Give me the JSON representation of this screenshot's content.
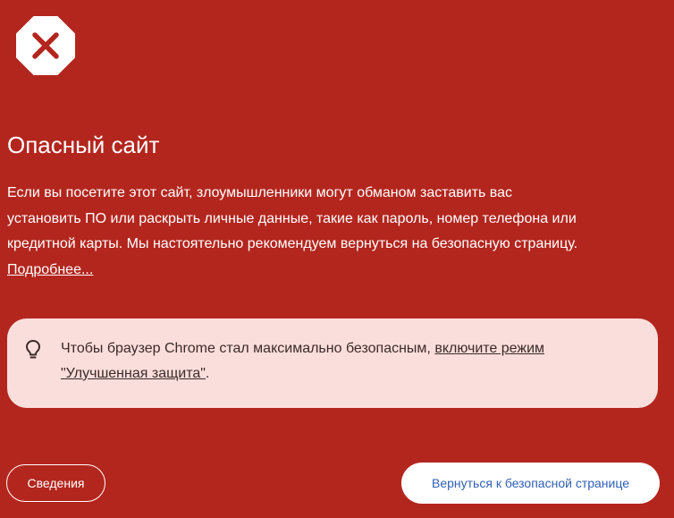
{
  "icons": {
    "warning": "close-x-octagon",
    "tip": "lightbulb"
  },
  "colors": {
    "background": "#b3261e",
    "tip_background": "#fadedc",
    "primary_button_text": "#2f5fb5"
  },
  "heading": {
    "title": "Опасный сайт"
  },
  "body": {
    "line1": "Если вы посетите этот сайт, злоумышленники могут обманом заставить вас",
    "line2": "установить ПО или раскрыть личные данные, такие как пароль, номер телефона или",
    "line3": "кредитной карты. Мы настоятельно рекомендуем вернуться на безопасную страницу.",
    "learn_more": "Подробнее..."
  },
  "tip": {
    "text": "Чтобы браузер Chrome стал максимально безопасным, ",
    "link_part1": "включите режим",
    "link_part2": "\"Улучшенная защита\"",
    "suffix": "."
  },
  "buttons": {
    "details": "Сведения",
    "back_to_safety": "Вернуться к безопасной странице"
  }
}
